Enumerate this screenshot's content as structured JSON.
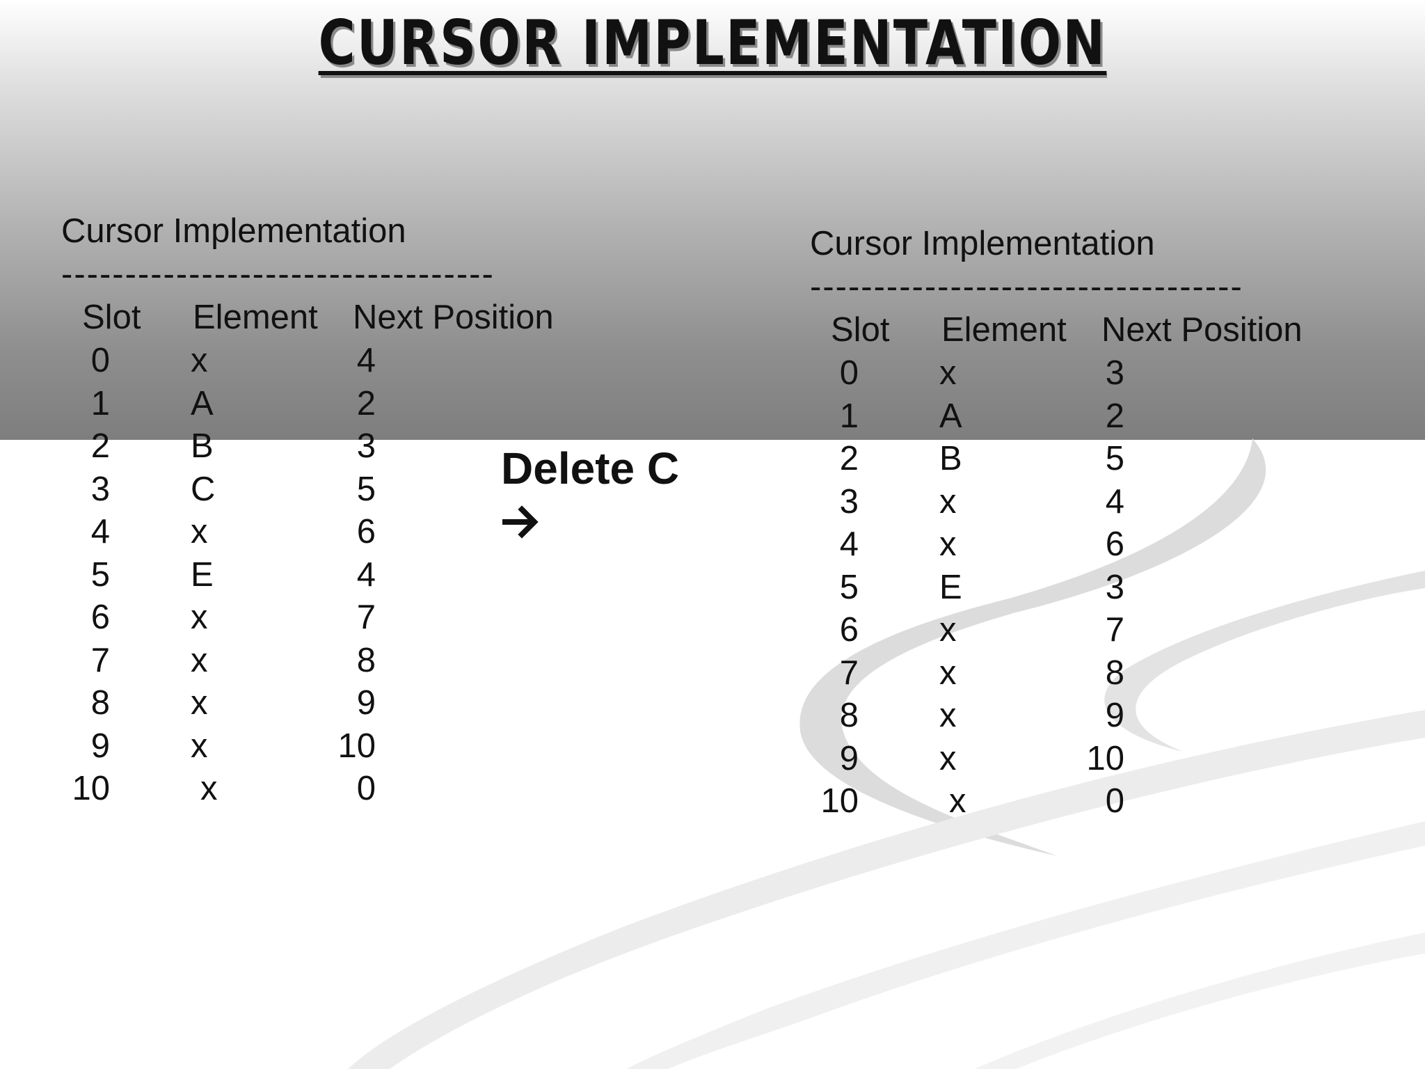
{
  "title": "CURSOR IMPLEMENTATION",
  "action": "Delete C",
  "arrow_icon": "right-arrow-icon",
  "tables": [
    {
      "caption": "Cursor Implementation",
      "rule": "----------------------------------",
      "headers": {
        "slot": "Slot",
        "element": "Element",
        "next": "Next Position"
      },
      "rows": [
        {
          "slot": "0",
          "element": "x",
          "next": "4"
        },
        {
          "slot": "1",
          "element": "A",
          "next": "2"
        },
        {
          "slot": "2",
          "element": "B",
          "next": "3"
        },
        {
          "slot": "3",
          "element": "C",
          "next": "5"
        },
        {
          "slot": "4",
          "element": "x",
          "next": "6"
        },
        {
          "slot": "5",
          "element": "E",
          "next": "4"
        },
        {
          "slot": "6",
          "element": "x",
          "next": "7"
        },
        {
          "slot": "7",
          "element": "x",
          "next": "8"
        },
        {
          "slot": "8",
          "element": "x",
          "next": "9"
        },
        {
          "slot": "9",
          "element": "x",
          "next": "10"
        },
        {
          "slot": "10",
          "element": "x",
          "next": "0"
        }
      ]
    },
    {
      "caption": "Cursor Implementation",
      "rule": "----------------------------------",
      "headers": {
        "slot": "Slot",
        "element": "Element",
        "next": "Next Position"
      },
      "rows": [
        {
          "slot": "0",
          "element": "x",
          "next": "3"
        },
        {
          "slot": "1",
          "element": "A",
          "next": "2"
        },
        {
          "slot": "2",
          "element": "B",
          "next": "5"
        },
        {
          "slot": "3",
          "element": "x",
          "next": "4"
        },
        {
          "slot": "4",
          "element": "x",
          "next": "6"
        },
        {
          "slot": "5",
          "element": "E",
          "next": "3"
        },
        {
          "slot": "6",
          "element": "x",
          "next": "7"
        },
        {
          "slot": "7",
          "element": "x",
          "next": "8"
        },
        {
          "slot": "8",
          "element": "x",
          "next": "9"
        },
        {
          "slot": "9",
          "element": "x",
          "next": "10"
        },
        {
          "slot": "10",
          "element": "x",
          "next": "0"
        }
      ]
    }
  ]
}
